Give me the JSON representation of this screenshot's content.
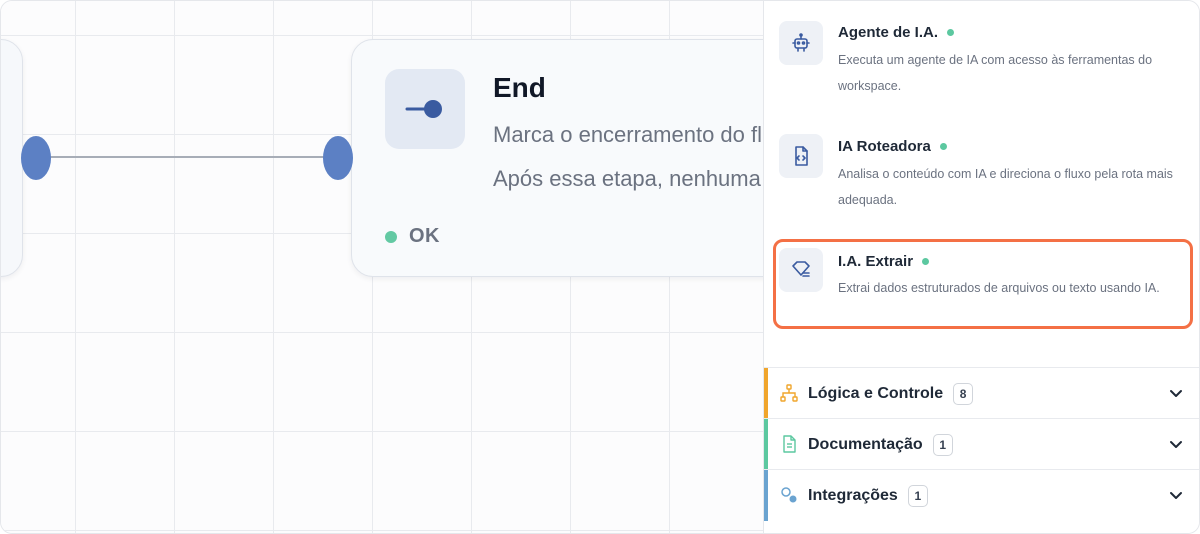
{
  "canvas": {
    "end_node": {
      "title": "End",
      "description_line1": "Marca o encerramento do fluxo.",
      "description_line2": "Após essa etapa, nenhuma ação",
      "status": "OK",
      "icon": "end-node-icon"
    }
  },
  "panel": {
    "items": [
      {
        "title": "Agente de I.A.",
        "description": "Executa um agente de IA com acesso às ferramentas do workspace.",
        "icon": "robot-icon"
      },
      {
        "title": "IA Roteadora",
        "description": "Analisa o conteúdo com IA e direciona o fluxo pela rota mais adequada.",
        "icon": "router-icon"
      },
      {
        "title": "I.A. Extrair",
        "description": "Extrai dados estruturados de arquivos ou texto usando IA.",
        "icon": "extract-icon",
        "highlighted": true
      }
    ],
    "sections": [
      {
        "label": "Lógica e Controle",
        "count": "8",
        "color": "#f0a52c",
        "icon": "hierarchy-icon"
      },
      {
        "label": "Documentação",
        "count": "1",
        "color": "#5cc8a0",
        "icon": "document-icon"
      },
      {
        "label": "Integrações",
        "count": "1",
        "color": "#6aa3d0",
        "icon": "integration-icon"
      }
    ]
  },
  "colors": {
    "accent": "#5c80c4",
    "status_ok": "#63c9a3",
    "highlight": "#f47045"
  }
}
